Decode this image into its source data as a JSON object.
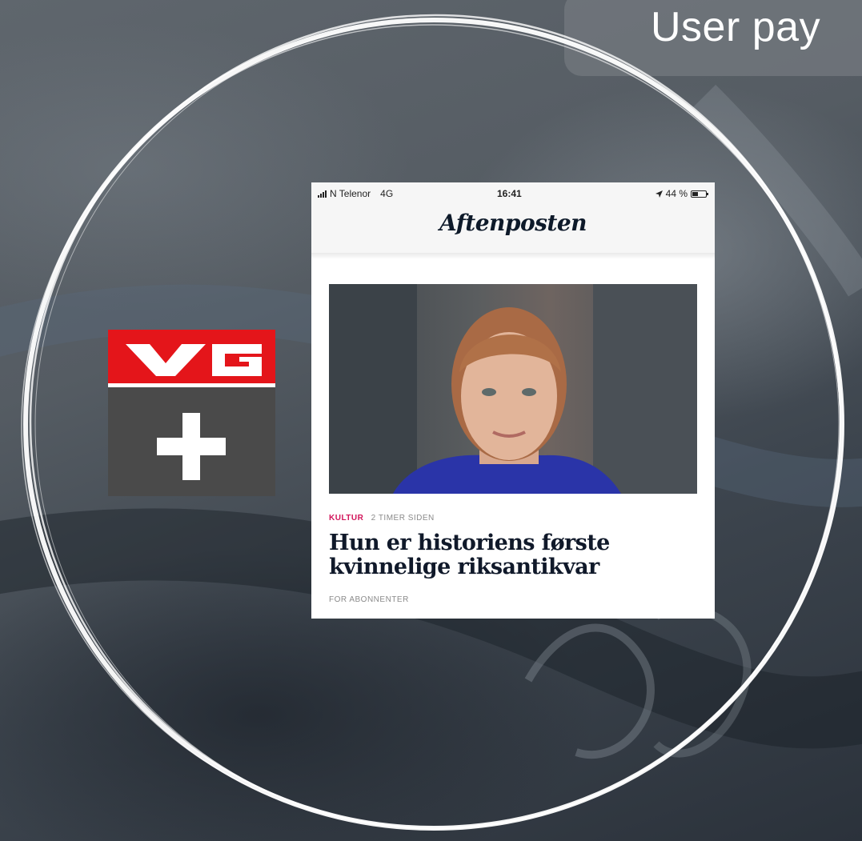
{
  "slide": {
    "title": "User pay"
  },
  "vg_logo": {
    "text": "VG",
    "plus": "+",
    "colors": {
      "red": "#e4151a",
      "dark": "#4a4a4a",
      "white": "#ffffff"
    }
  },
  "phone": {
    "status_bar": {
      "carrier": "N Telenor",
      "network": "4G",
      "time": "16:41",
      "location_icon": "location-arrow-icon",
      "battery": "44 %"
    },
    "masthead": "Aftenposten",
    "article": {
      "category": "KULTUR",
      "time": "2 TIMER SIDEN",
      "headline_line1": "Hun er historiens første",
      "headline_line2": "kvinnelige riksantikvar",
      "label": "FOR ABONNENTER",
      "category_color": "#d2145a"
    }
  }
}
